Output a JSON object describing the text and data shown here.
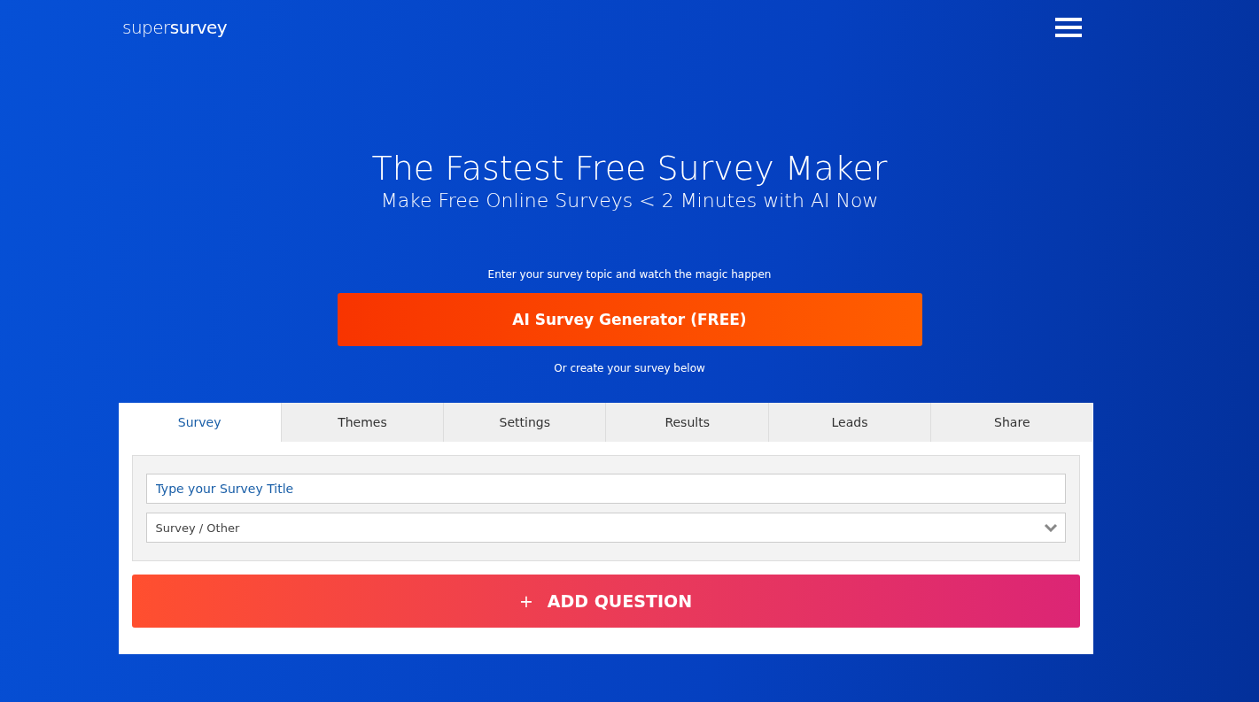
{
  "header": {
    "logo": "super**survey**"
  },
  "hero": {
    "title": "The Fastest Free Survey Maker",
    "subtitle": "Make Free Online Surveys < 2 Minutes with AI Now"
  },
  "ai": {
    "prompt": "Enter your survey topic and watch the magic happen",
    "button": "AI Survey Generator (FREE)",
    "alt": "Or create your survey below"
  },
  "tabs": [
    {
      "label": "Survey",
      "selected": true
    },
    {
      "label": "Themes",
      "selected": false
    },
    {
      "label": "Settings",
      "selected": false
    },
    {
      "label": "Results",
      "selected": false
    },
    {
      "label": "Leads",
      "selected": false
    },
    {
      "label": "Share",
      "selected": false
    }
  ],
  "form": {
    "title_field": {
      "placeholder": "Type your Survey Title"
    },
    "category": {
      "value": "Survey / Other"
    }
  },
  "add_question": {
    "icon": "+",
    "label": "ADD QUESTION"
  }
}
